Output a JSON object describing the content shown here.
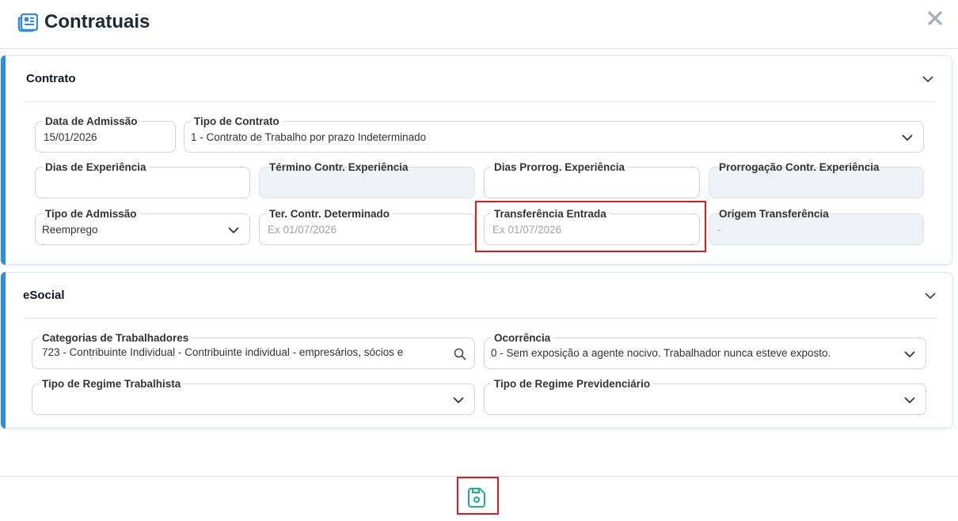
{
  "header": {
    "title": "Contratuais",
    "title_icon": "document-list-icon",
    "close_icon": "close-icon"
  },
  "contrato": {
    "title": "Contrato",
    "fields": {
      "data_admissao": {
        "label": "Data de Admissão",
        "value": "15/01/2026"
      },
      "tipo_contrato": {
        "label": "Tipo de Contrato",
        "value": "1 - Contrato de Trabalho por prazo Indeterminado"
      },
      "dias_experiencia": {
        "label": "Dias de Experiência",
        "value": ""
      },
      "termino_contr_experiencia": {
        "label": "Término Contr. Experiência",
        "value": ""
      },
      "dias_prorrog_experiencia": {
        "label": "Dias Prorrog. Experiência",
        "value": ""
      },
      "prorrogacao_contr_experiencia": {
        "label": "Prorrogação Contr. Experiência",
        "value": ""
      },
      "tipo_admissao": {
        "label": "Tipo de Admissão",
        "value": "Reemprego"
      },
      "ter_contr_determinado": {
        "label": "Ter. Contr. Determinado",
        "placeholder": "Ex 01/07/2026"
      },
      "transferencia_entrada": {
        "label": "Transferência Entrada",
        "placeholder": "Ex 01/07/2026"
      },
      "origem_transferencia": {
        "label": "Origem Transferência",
        "value": "-"
      }
    }
  },
  "esocial": {
    "title": "eSocial",
    "fields": {
      "categorias_trabalhadores": {
        "label": "Categorias de Trabalhadores",
        "value": "723 - Contribuinte Individual - Contribuinte individual - empresários, sócios e"
      },
      "ocorrencia": {
        "label": "Ocorrência",
        "value": "0 - Sem exposição a agente nocivo. Trabalhador nunca esteve exposto."
      },
      "tipo_regime_trabalhista": {
        "label": "Tipo de Regime Trabalhista",
        "value": ""
      },
      "tipo_regime_previdenciario": {
        "label": "Tipo de Regime Previdenciário",
        "value": ""
      }
    }
  },
  "footer": {
    "save_icon": "save-icon"
  },
  "colors": {
    "accent": "#2e8ce6",
    "highlight": "#e01b1b",
    "save": "#1fae8a"
  }
}
